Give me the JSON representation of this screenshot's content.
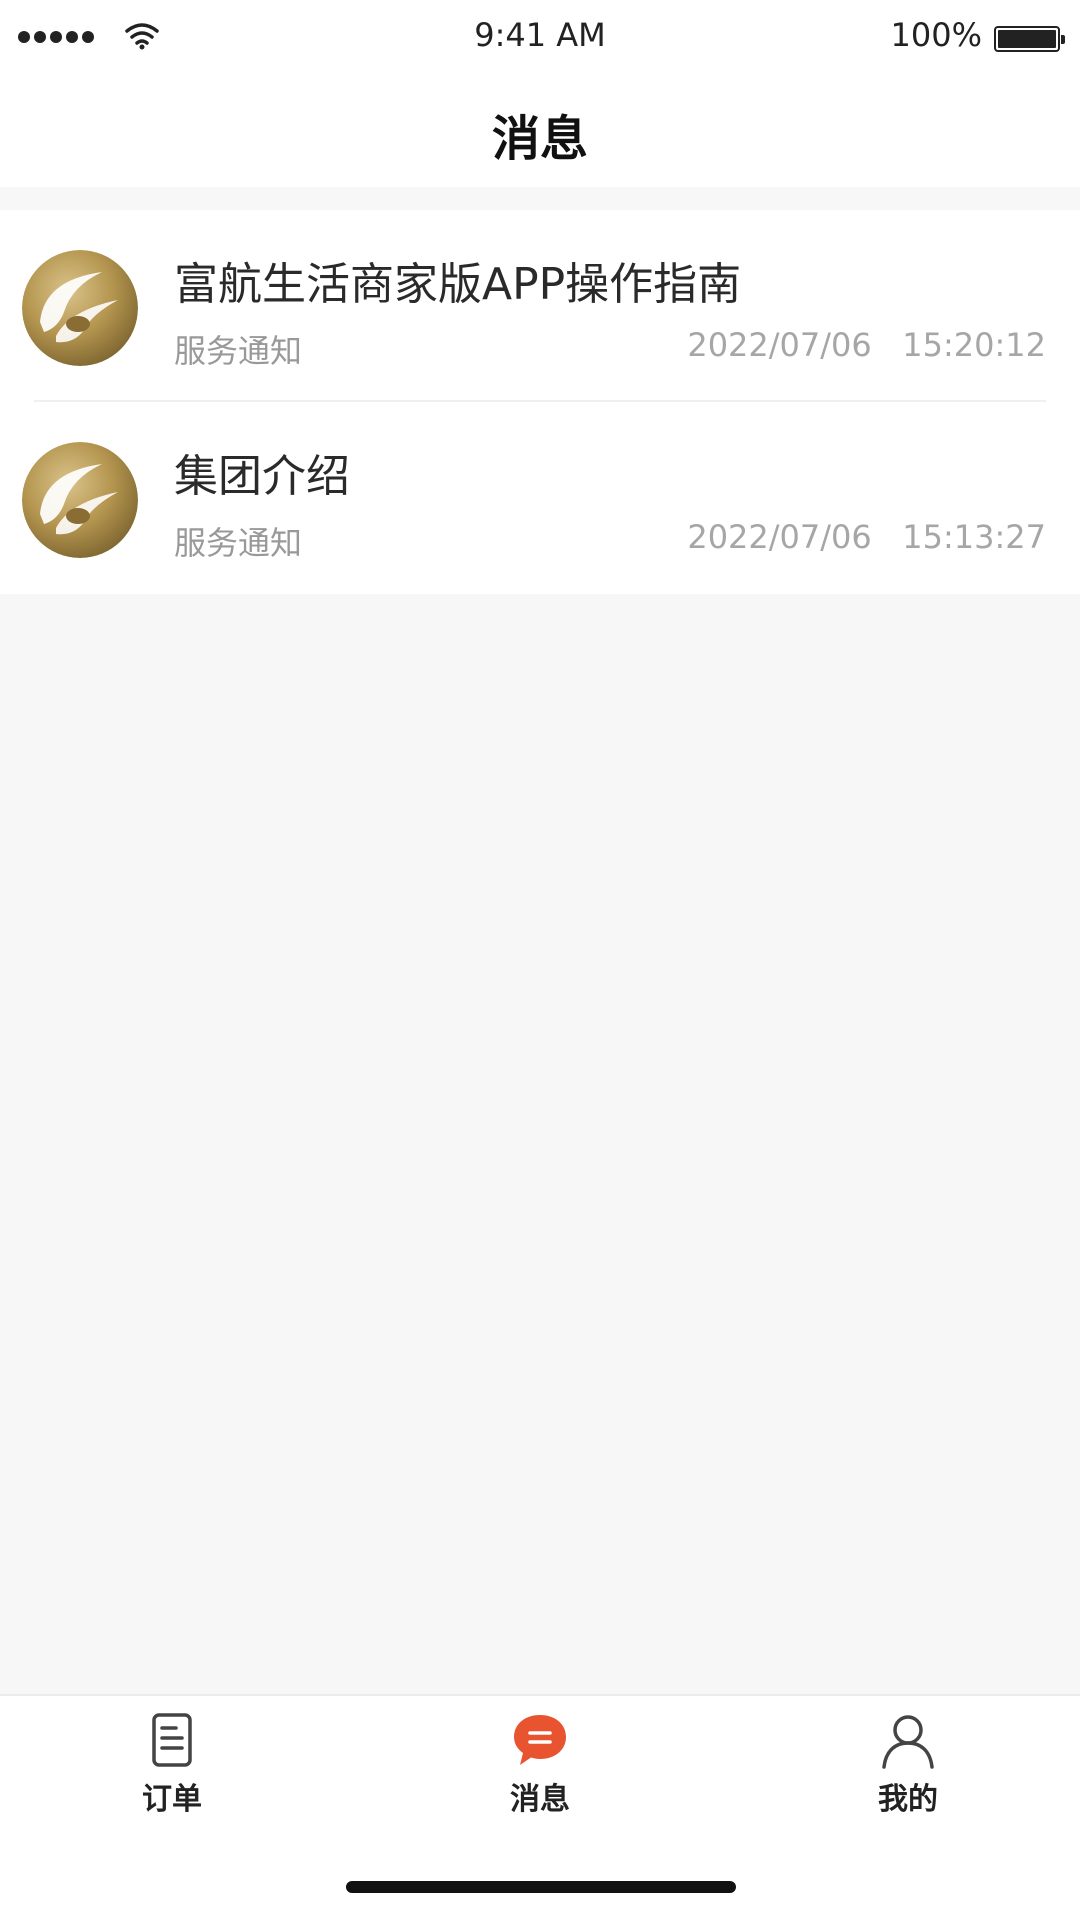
{
  "status_bar": {
    "time": "9:41 AM",
    "battery": "100%"
  },
  "header": {
    "title": "消息"
  },
  "messages": [
    {
      "title": "富航生活商家版APP操作指南",
      "type": "服务通知",
      "date": "2022/07/06",
      "time": "15:20:12"
    },
    {
      "title": "集团介绍",
      "type": "服务通知",
      "date": "2022/07/06",
      "time": "15:13:27"
    }
  ],
  "tabs": [
    {
      "label": "订单",
      "icon": "document-list-icon"
    },
    {
      "label": "消息",
      "icon": "chat-bubble-icon",
      "active": true
    },
    {
      "label": "我的",
      "icon": "user-icon"
    }
  ],
  "colors": {
    "accent": "#e8542f",
    "logo_gold": "#b4954f",
    "background": "#f7f7f7"
  }
}
